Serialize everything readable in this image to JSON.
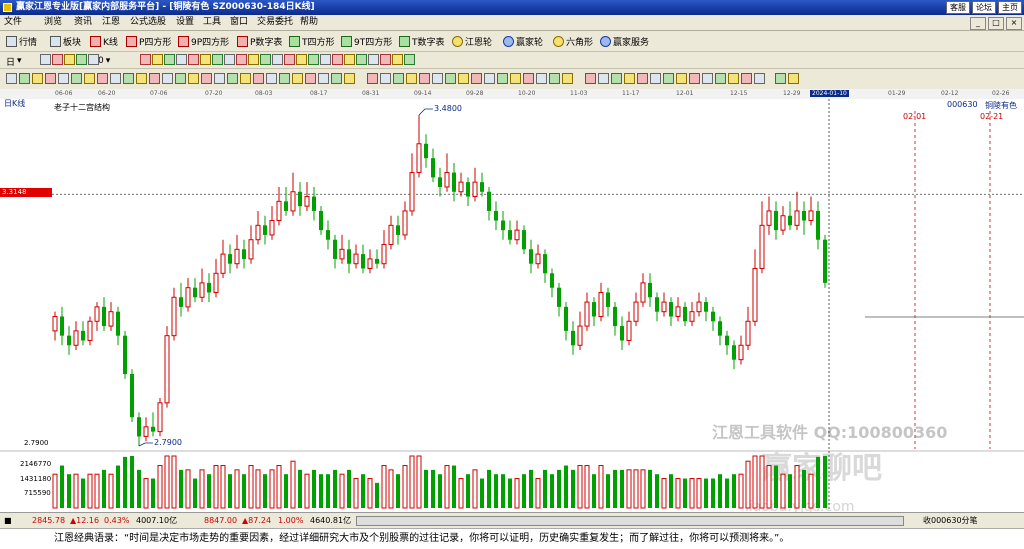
{
  "window": {
    "title": "赢家江恩专业版[赢家内部服务平台] - [铜陵有色  SZ000630-184日K线]",
    "links": [
      "客服",
      "论坛",
      "主页"
    ],
    "buttons": [
      "_",
      "□",
      "×"
    ]
  },
  "menu": [
    "文件",
    "浏览",
    "资讯",
    "江恩",
    "公式选股",
    "设置",
    "工具",
    "窗口",
    "交易委托",
    "帮助"
  ],
  "toolbar1": [
    "行情",
    "板块",
    "K线",
    "P四方形",
    "9P四方形",
    "P数字表",
    "T四方形",
    "9T四方形",
    "T数字表",
    "江恩轮",
    "赢家轮",
    "六角形",
    "赢家服务"
  ],
  "toolbar2": {
    "dropdown1": "日",
    "dropdown2": "0"
  },
  "chart": {
    "period_label": "日K线",
    "indicator_name": "老子十二宫结构",
    "stock_code": "000630",
    "stock_name": "铜陵有色",
    "current_price_label": "3.3148",
    "low_scale_label": "2.7900",
    "high_annotation": "3.4800",
    "low_annotation": "2.7900",
    "future_dates": [
      "02-01",
      "02-21"
    ],
    "watermark_1": "江恩工具软件  QQ:100800360",
    "watermark_2": "赢家聊吧",
    "watermark_3": "liaoba.yjgs.com",
    "date_ticks": [
      "06-06",
      "06-20",
      "07-06",
      "07-20",
      "08-03",
      "08-17",
      "08-31",
      "09-14",
      "09-28",
      "10-20",
      "11-03",
      "11-17",
      "12-01",
      "12-15",
      "12-29",
      "2024-01-10",
      "01-29",
      "02-12",
      "02-26"
    ],
    "highlight_date": "2024-01-10",
    "volume_labels": [
      "2146770",
      "1431180",
      "715590"
    ],
    "colors": {
      "up": "#d00000",
      "down": "#00a000",
      "accent": "#0a2a8c"
    }
  },
  "chart_data": {
    "type": "candlestick",
    "price_range": [
      2.79,
      3.48
    ],
    "values": [
      [
        3.03,
        3.06,
        3.07,
        3.01
      ],
      [
        3.06,
        3.02,
        3.08,
        3.0
      ],
      [
        3.02,
        3.0,
        3.04,
        2.98
      ],
      [
        3.0,
        3.03,
        3.05,
        2.99
      ],
      [
        3.03,
        3.01,
        3.05,
        3.0
      ],
      [
        3.01,
        3.05,
        3.06,
        3.0
      ],
      [
        3.05,
        3.08,
        3.09,
        3.03
      ],
      [
        3.08,
        3.04,
        3.1,
        3.03
      ],
      [
        3.04,
        3.07,
        3.09,
        3.03
      ],
      [
        3.07,
        3.02,
        3.08,
        3.0
      ],
      [
        3.02,
        2.94,
        3.03,
        2.93
      ],
      [
        2.94,
        2.85,
        2.95,
        2.84
      ],
      [
        2.85,
        2.81,
        2.86,
        2.79
      ],
      [
        2.81,
        2.83,
        2.85,
        2.8
      ],
      [
        2.83,
        2.82,
        2.86,
        2.81
      ],
      [
        2.82,
        2.88,
        2.89,
        2.81
      ],
      [
        2.88,
        3.02,
        3.04,
        2.87
      ],
      [
        3.02,
        3.1,
        3.12,
        3.01
      ],
      [
        3.1,
        3.08,
        3.13,
        3.06
      ],
      [
        3.08,
        3.12,
        3.14,
        3.07
      ],
      [
        3.12,
        3.1,
        3.14,
        3.09
      ],
      [
        3.1,
        3.13,
        3.16,
        3.09
      ],
      [
        3.13,
        3.11,
        3.15,
        3.09
      ],
      [
        3.11,
        3.15,
        3.18,
        3.1
      ],
      [
        3.15,
        3.19,
        3.22,
        3.14
      ],
      [
        3.19,
        3.17,
        3.21,
        3.15
      ],
      [
        3.17,
        3.2,
        3.23,
        3.16
      ],
      [
        3.2,
        3.18,
        3.22,
        3.16
      ],
      [
        3.18,
        3.22,
        3.25,
        3.17
      ],
      [
        3.22,
        3.25,
        3.28,
        3.21
      ],
      [
        3.25,
        3.23,
        3.27,
        3.21
      ],
      [
        3.23,
        3.26,
        3.29,
        3.22
      ],
      [
        3.26,
        3.3,
        3.33,
        3.25
      ],
      [
        3.3,
        3.28,
        3.33,
        3.27
      ],
      [
        3.28,
        3.32,
        3.36,
        3.27
      ],
      [
        3.32,
        3.29,
        3.34,
        3.27
      ],
      [
        3.29,
        3.31,
        3.34,
        3.28
      ],
      [
        3.31,
        3.28,
        3.33,
        3.26
      ],
      [
        3.28,
        3.24,
        3.29,
        3.23
      ],
      [
        3.24,
        3.22,
        3.26,
        3.2
      ],
      [
        3.22,
        3.18,
        3.23,
        3.16
      ],
      [
        3.18,
        3.2,
        3.23,
        3.17
      ],
      [
        3.2,
        3.17,
        3.22,
        3.15
      ],
      [
        3.17,
        3.19,
        3.21,
        3.16
      ],
      [
        3.19,
        3.16,
        3.21,
        3.15
      ],
      [
        3.16,
        3.18,
        3.2,
        3.15
      ],
      [
        3.18,
        3.17,
        3.2,
        3.16
      ],
      [
        3.17,
        3.21,
        3.24,
        3.16
      ],
      [
        3.21,
        3.25,
        3.27,
        3.2
      ],
      [
        3.25,
        3.23,
        3.27,
        3.21
      ],
      [
        3.23,
        3.28,
        3.3,
        3.22
      ],
      [
        3.28,
        3.36,
        3.4,
        3.27
      ],
      [
        3.36,
        3.42,
        3.48,
        3.35
      ],
      [
        3.42,
        3.39,
        3.44,
        3.37
      ],
      [
        3.39,
        3.35,
        3.41,
        3.34
      ],
      [
        3.35,
        3.33,
        3.37,
        3.31
      ],
      [
        3.33,
        3.36,
        3.4,
        3.32
      ],
      [
        3.36,
        3.32,
        3.38,
        3.3
      ],
      [
        3.32,
        3.34,
        3.36,
        3.31
      ],
      [
        3.34,
        3.31,
        3.35,
        3.29
      ],
      [
        3.31,
        3.34,
        3.37,
        3.3
      ],
      [
        3.34,
        3.32,
        3.36,
        3.31
      ],
      [
        3.32,
        3.28,
        3.33,
        3.26
      ],
      [
        3.28,
        3.26,
        3.3,
        3.24
      ],
      [
        3.26,
        3.24,
        3.28,
        3.22
      ],
      [
        3.24,
        3.22,
        3.26,
        3.21
      ],
      [
        3.22,
        3.24,
        3.26,
        3.21
      ],
      [
        3.24,
        3.2,
        3.25,
        3.19
      ],
      [
        3.2,
        3.17,
        3.22,
        3.15
      ],
      [
        3.17,
        3.19,
        3.21,
        3.16
      ],
      [
        3.19,
        3.15,
        3.2,
        3.13
      ],
      [
        3.15,
        3.12,
        3.16,
        3.1
      ],
      [
        3.12,
        3.08,
        3.13,
        3.06
      ],
      [
        3.08,
        3.03,
        3.09,
        3.01
      ],
      [
        3.03,
        3.0,
        3.05,
        2.98
      ],
      [
        3.0,
        3.04,
        3.07,
        2.99
      ],
      [
        3.04,
        3.09,
        3.11,
        3.03
      ],
      [
        3.09,
        3.06,
        3.1,
        3.04
      ],
      [
        3.06,
        3.11,
        3.13,
        3.05
      ],
      [
        3.11,
        3.08,
        3.12,
        3.06
      ],
      [
        3.08,
        3.04,
        3.09,
        3.02
      ],
      [
        3.04,
        3.01,
        3.06,
        2.99
      ],
      [
        3.01,
        3.05,
        3.07,
        3.0
      ],
      [
        3.05,
        3.09,
        3.11,
        3.04
      ],
      [
        3.09,
        3.13,
        3.15,
        3.08
      ],
      [
        3.13,
        3.1,
        3.15,
        3.08
      ],
      [
        3.1,
        3.07,
        3.11,
        3.05
      ],
      [
        3.07,
        3.09,
        3.11,
        3.06
      ],
      [
        3.09,
        3.06,
        3.1,
        3.04
      ],
      [
        3.06,
        3.08,
        3.1,
        3.05
      ],
      [
        3.08,
        3.05,
        3.09,
        3.04
      ],
      [
        3.05,
        3.07,
        3.09,
        3.04
      ],
      [
        3.07,
        3.09,
        3.11,
        3.06
      ],
      [
        3.09,
        3.07,
        3.1,
        3.05
      ],
      [
        3.07,
        3.05,
        3.08,
        3.03
      ],
      [
        3.05,
        3.02,
        3.06,
        3.0
      ],
      [
        3.02,
        3.0,
        3.03,
        2.98
      ],
      [
        3.0,
        2.97,
        3.01,
        2.95
      ],
      [
        2.97,
        3.0,
        3.02,
        2.96
      ],
      [
        3.0,
        3.05,
        3.08,
        2.99
      ],
      [
        3.05,
        3.16,
        3.2,
        3.04
      ],
      [
        3.16,
        3.25,
        3.3,
        3.15
      ],
      [
        3.25,
        3.28,
        3.31,
        3.23
      ],
      [
        3.28,
        3.24,
        3.3,
        3.22
      ],
      [
        3.24,
        3.27,
        3.29,
        3.23
      ],
      [
        3.27,
        3.25,
        3.3,
        3.24
      ],
      [
        3.25,
        3.28,
        3.32,
        3.24
      ],
      [
        3.28,
        3.26,
        3.3,
        3.23
      ],
      [
        3.26,
        3.28,
        3.31,
        3.25
      ],
      [
        3.28,
        3.22,
        3.3,
        3.2
      ],
      [
        3.22,
        3.13,
        3.23,
        3.12
      ]
    ]
  },
  "status": {
    "index1_value": "2845.78",
    "index1_change": "▲12.16",
    "index1_pct": "0.43%",
    "index1_amount": "4007.10亿",
    "index2_value": "8847.00",
    "index2_change": "▲87.24",
    "index2_pct": "1.00%",
    "index2_amount": "4640.81亿",
    "right_text": "收000630分笔"
  },
  "quote": "江恩经典语录：“时间是决定市场走势的重要因素，经过详细研究大市及个别股票的过往记录，你将可以证明，历史确实重复发生；而了解过往，你将可以预测将来。”。"
}
